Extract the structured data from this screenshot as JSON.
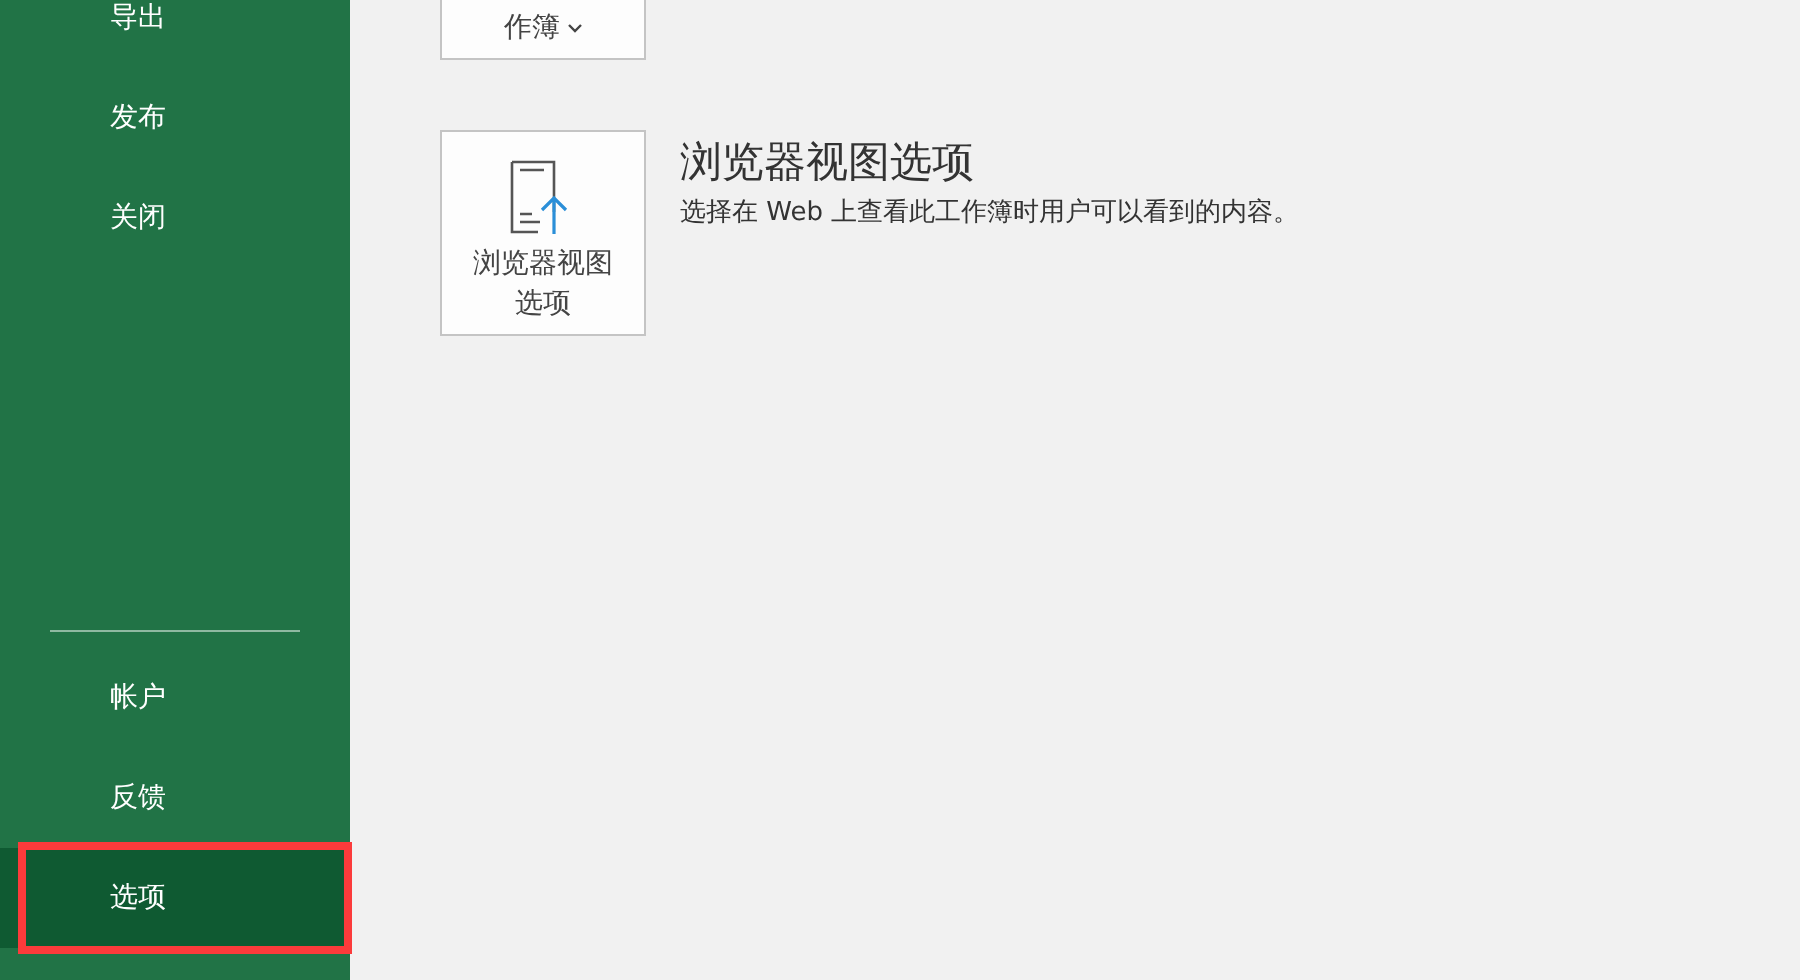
{
  "sidebar": {
    "top_items": [
      {
        "label": "导出",
        "selected": false
      },
      {
        "label": "发布",
        "selected": false
      },
      {
        "label": "关闭",
        "selected": false
      }
    ],
    "bottom_items": [
      {
        "label": "帐户",
        "selected": false
      },
      {
        "label": "反馈",
        "selected": false
      },
      {
        "label": "选项",
        "selected": true
      }
    ]
  },
  "content": {
    "cut_button": {
      "label": "作簿"
    },
    "option": {
      "button_label": "浏览器视图选项",
      "title": "浏览器视图选项",
      "description": "选择在 Web 上查看此工作簿时用户可以看到的内容。"
    }
  }
}
